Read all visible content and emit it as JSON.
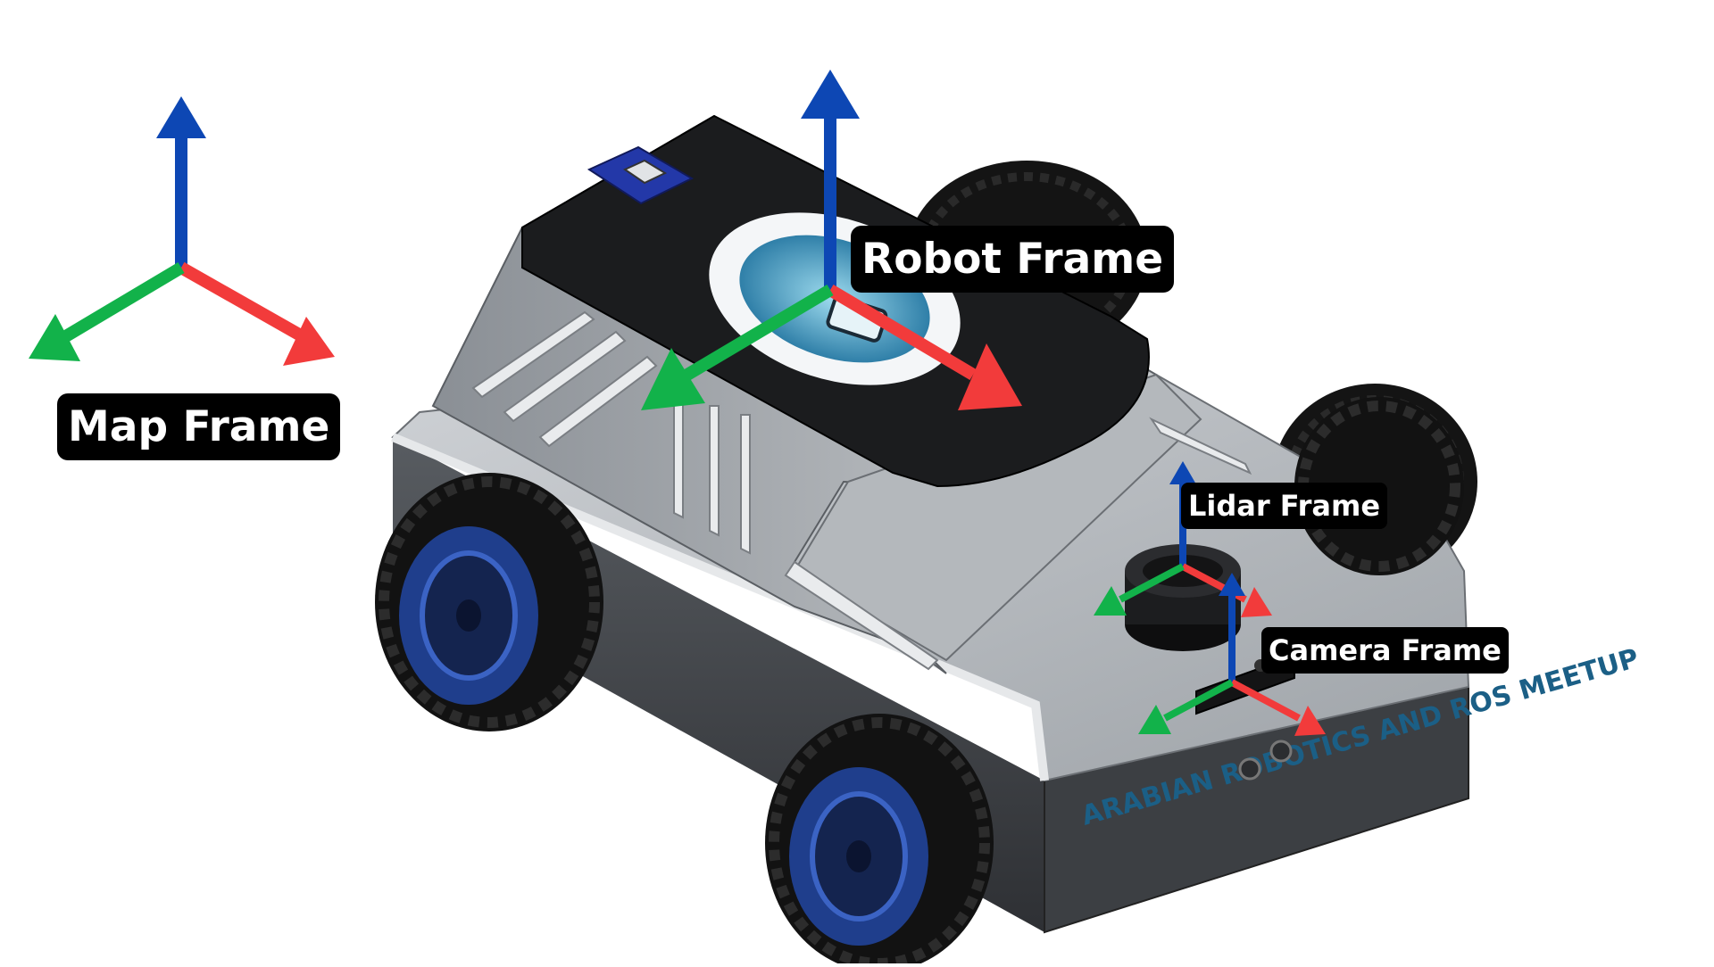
{
  "labels": {
    "map_frame": "Map Frame",
    "robot_frame": "Robot Frame",
    "lidar_frame": "Lidar Frame",
    "camera_frame": "Camera Frame"
  },
  "robot": {
    "front_engraving": "ARABIAN ROBOTICS AND ROS MEETUP",
    "logo_ring_text": "ARABIAN ROBOTICS AND ROS MEETUP"
  },
  "colors": {
    "z_axis": "#0d47b4",
    "x_axis": "#f23b3b",
    "y_axis": "#12b24a",
    "label_bg": "#000000",
    "label_text": "#ffffff",
    "body_silver": "#b9bdc1",
    "body_dark": "#3a3d41",
    "roof": "#1b1c1e",
    "rim": "#1f3e8c"
  },
  "icons": {
    "axis_triad": "axis-triad-icon",
    "gps_module": "gps-module-icon",
    "lidar_sensor": "lidar-sensor-icon",
    "camera_sensor": "camera-sensor-icon"
  }
}
